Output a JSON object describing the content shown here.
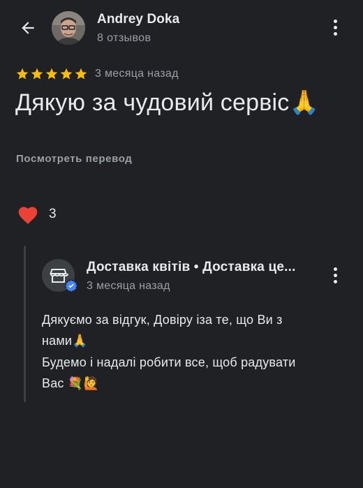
{
  "author": {
    "name": "Andrey Doka",
    "reviews_count": "8 отзывов"
  },
  "review": {
    "rating": 5,
    "date": "3 месяца назад",
    "text": "Дякую за чудовий сервіс",
    "text_emoji": "🙏",
    "translate_label": "Посмотреть перевод"
  },
  "likes": {
    "icon": "heart-icon",
    "count": "3"
  },
  "reply": {
    "business_name": "Доставка квітів • Доставка це...",
    "date": "3 месяца назад",
    "lines": [
      "Дякуємо за відгук, Довіру іза те, що Ви з",
      "нами",
      "Будемо і надалі робити все, щоб радувати",
      "Вас"
    ],
    "line2_emoji": "🙏",
    "line4_emoji": "💐🙋"
  },
  "colors": {
    "background": "#202124",
    "star": "#fbbc04",
    "heart": "#ea4335",
    "verified": "#4285f4",
    "muted_text": "#9aa0a6"
  }
}
